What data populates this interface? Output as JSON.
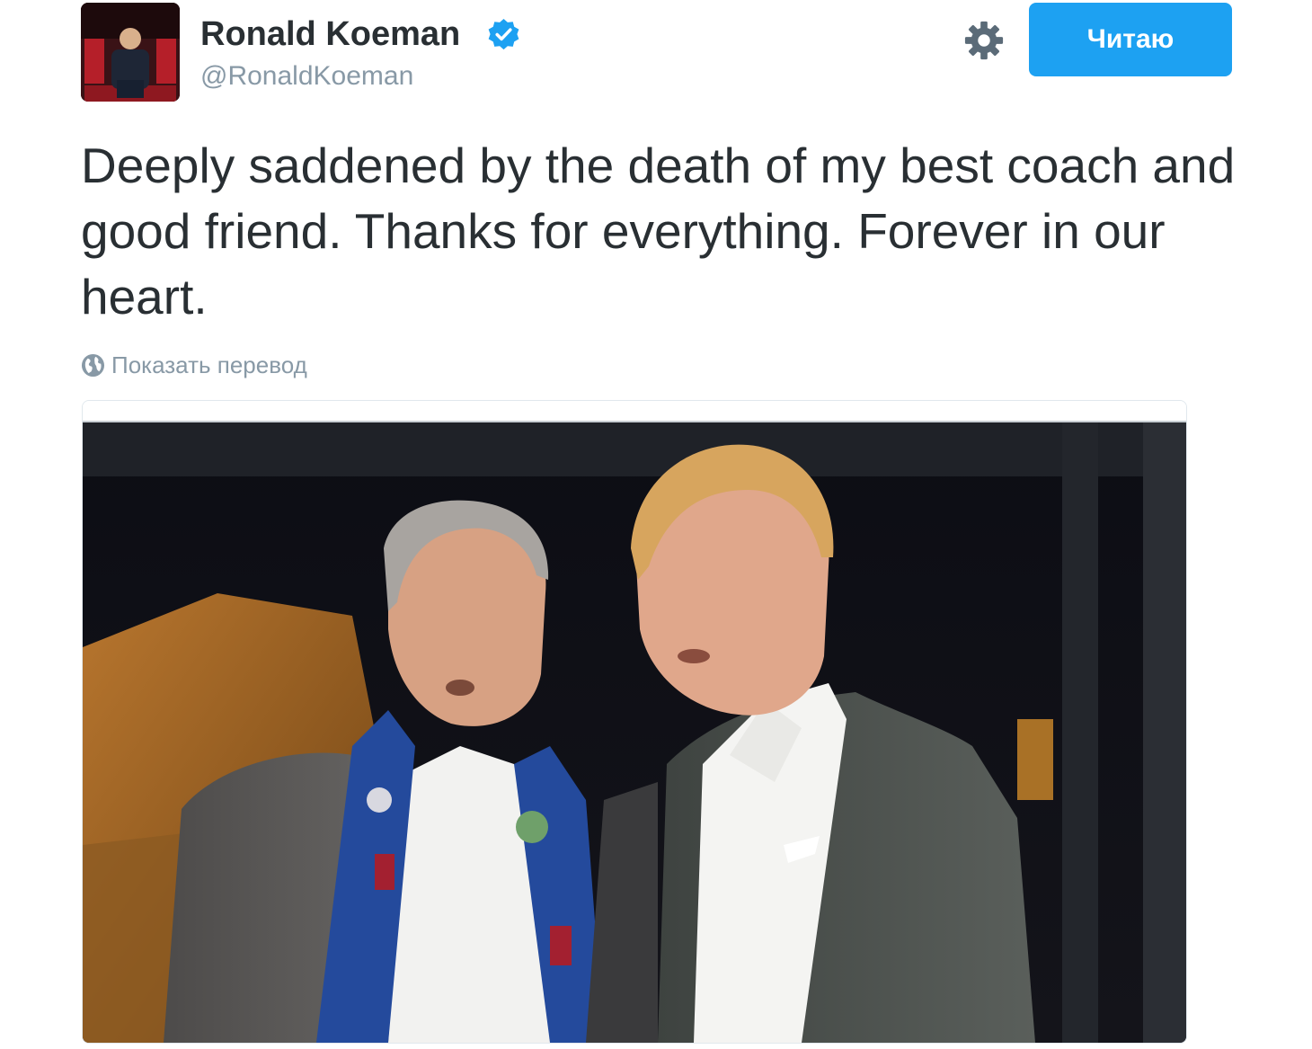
{
  "user": {
    "display_name": "Ronald Koeman",
    "handle": "@RonaldKoeman",
    "verified": true
  },
  "actions": {
    "follow_label": "Читаю",
    "settings_icon": "gear-icon"
  },
  "tweet": {
    "text": "Deeply saddened by the death of my best coach and good friend. Thanks for everything. Forever in our heart.",
    "translate_label": "Показать перевод",
    "translate_icon": "globe-icon"
  },
  "media": {
    "type": "photo"
  },
  "colors": {
    "accent": "#1da1f2",
    "secondary_text": "#8899a6",
    "primary_text": "#292f33",
    "verified_badge": "#1da1f2"
  }
}
